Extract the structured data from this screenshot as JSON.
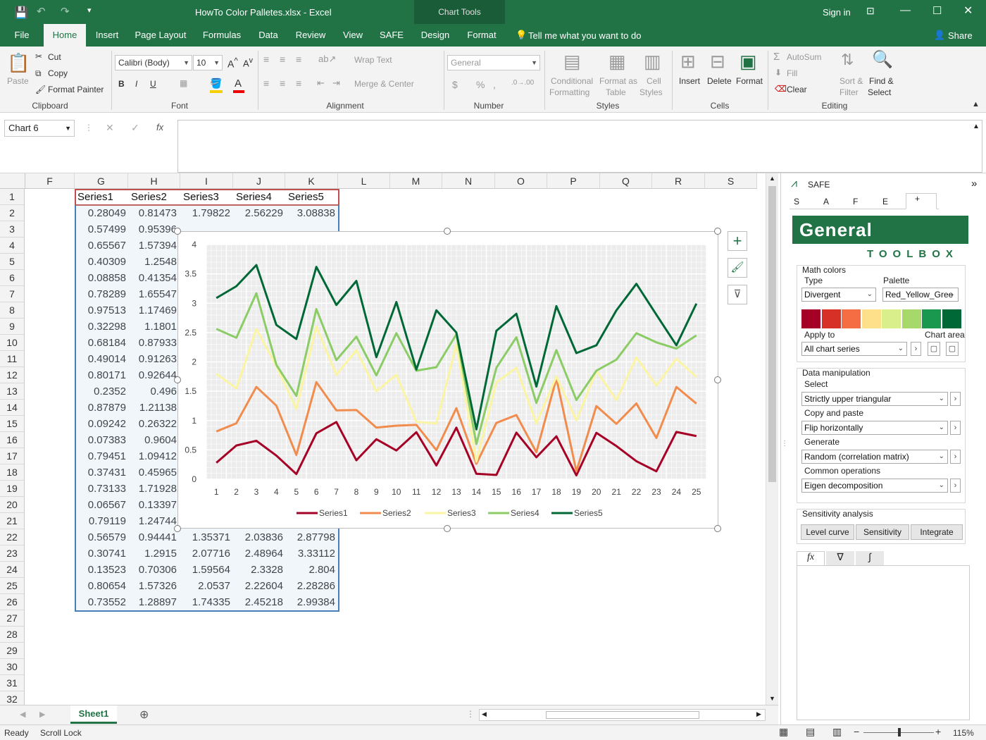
{
  "app": {
    "title": "HowTo Color Palletes.xlsx - Excel",
    "signin": "Sign in",
    "share": "Share",
    "chart_tools": "Chart Tools"
  },
  "tabs": [
    "File",
    "Home",
    "Insert",
    "Page Layout",
    "Formulas",
    "Data",
    "Review",
    "View",
    "SAFE",
    "Design",
    "Format"
  ],
  "tell_me": "Tell me what you want to do",
  "ribbon": {
    "clipboard": {
      "paste": "Paste",
      "cut": "Cut",
      "copy": "Copy",
      "format_painter": "Format Painter",
      "label": "Clipboard"
    },
    "font": {
      "name": "Calibri (Body)",
      "size": "10",
      "bold": "B",
      "italic": "I",
      "underline": "U",
      "label": "Font"
    },
    "alignment": {
      "wrap": "Wrap Text",
      "merge": "Merge & Center",
      "label": "Alignment"
    },
    "number": {
      "format": "General",
      "currency": "$",
      "percent": "%",
      "comma": ",",
      "label": "Number"
    },
    "styles": {
      "conditional": "Conditional",
      "formatting": "Formatting",
      "format_as": "Format as",
      "table": "Table",
      "cell": "Cell",
      "cell_styles": "Styles",
      "label": "Styles"
    },
    "cells": {
      "insert": "Insert",
      "delete": "Delete",
      "format": "Format",
      "label": "Cells"
    },
    "editing": {
      "autosum": "AutoSum",
      "fill": "Fill",
      "clear": "Clear",
      "sort": "Sort &",
      "filter": "Filter",
      "find": "Find &",
      "select": "Select",
      "label": "Editing"
    }
  },
  "formula_bar": {
    "name_box": "Chart 6",
    "fx": "fx",
    "value": ""
  },
  "grid": {
    "columns": [
      "F",
      "G",
      "H",
      "I",
      "J",
      "K",
      "L",
      "M",
      "N",
      "O",
      "P",
      "Q",
      "R",
      "S"
    ],
    "rows": [
      "1",
      "2",
      "3",
      "4",
      "5",
      "6",
      "7",
      "8",
      "9",
      "10",
      "11",
      "12",
      "13",
      "14",
      "15",
      "16",
      "17",
      "18",
      "19",
      "20",
      "21",
      "22",
      "23",
      "24",
      "25",
      "26",
      "27",
      "28",
      "29",
      "30",
      "31",
      "32"
    ],
    "headers": [
      "Series1",
      "Series2",
      "Series3",
      "Series4",
      "Series5"
    ],
    "visible_G": [
      "0.28049",
      "0.57499",
      "0.65567",
      "0.40309",
      "0.08858",
      "0.78289",
      "0.97513",
      "0.32298",
      "0.68184",
      "0.49014",
      "0.80171",
      "0.2352",
      "0.87879",
      "0.09242",
      "0.07383",
      "0.79451",
      "0.37431",
      "0.73133",
      "0.06567",
      "0.79119",
      "0.56579",
      "0.30741",
      "0.13523",
      "0.80654",
      "0.73552"
    ],
    "visible_H": [
      "0.81473",
      "0.95396",
      "1.57394",
      "1.2548",
      "0.41354",
      "1.65547",
      "1.17469",
      "1.1801",
      "0.87933",
      "0.91263",
      "0.92644",
      "0.496",
      "1.21138",
      "0.26322",
      "0.9604",
      "1.09412",
      "0.45965",
      "1.71928",
      "0.13397",
      "1.24744",
      "0.94441",
      "1.2915",
      "0.70306",
      "1.57326",
      "1.28897"
    ],
    "row2_IJK": [
      "1.79822",
      "2.56229",
      "3.08838"
    ],
    "row3_IJK": [
      "1.54586",
      "2.4115",
      "3.28976"
    ],
    "rows22_26_IJK": [
      [
        "1.35371",
        "2.03836",
        "2.87798"
      ],
      [
        "2.07716",
        "2.48964",
        "3.33112"
      ],
      [
        "1.59564",
        "2.3328",
        "2.804"
      ],
      [
        "2.0537",
        "2.22604",
        "2.28286"
      ],
      [
        "1.74335",
        "2.45218",
        "2.99384"
      ]
    ]
  },
  "chart_data": {
    "type": "line",
    "x": [
      1,
      2,
      3,
      4,
      5,
      6,
      7,
      8,
      9,
      10,
      11,
      12,
      13,
      14,
      15,
      16,
      17,
      18,
      19,
      20,
      21,
      22,
      23,
      24,
      25
    ],
    "ylim": [
      0,
      4
    ],
    "yticks": [
      "0",
      "0.5",
      "1",
      "1.5",
      "2",
      "2.5",
      "3",
      "3.5",
      "4"
    ],
    "grid": true,
    "legend_position": "bottom",
    "series": [
      {
        "name": "Series1",
        "color": "#a50026",
        "values": [
          0.28049,
          0.57499,
          0.65567,
          0.40309,
          0.08858,
          0.78289,
          0.97513,
          0.32298,
          0.68184,
          0.49014,
          0.80171,
          0.2352,
          0.87879,
          0.09242,
          0.07383,
          0.79451,
          0.37431,
          0.73133,
          0.06567,
          0.79119,
          0.56579,
          0.30741,
          0.13523,
          0.80654,
          0.73552
        ]
      },
      {
        "name": "Series2",
        "color": "#f08c4e",
        "values": [
          0.81473,
          0.95396,
          1.57394,
          1.2548,
          0.41354,
          1.65547,
          1.17469,
          1.1801,
          0.87933,
          0.91263,
          0.92644,
          0.496,
          1.21138,
          0.26322,
          0.9604,
          1.09412,
          0.45965,
          1.71928,
          0.13397,
          1.24744,
          0.94441,
          1.2915,
          0.70306,
          1.57326,
          1.28897
        ]
      },
      {
        "name": "Series3",
        "color": "#fbf5a3",
        "values": [
          1.79822,
          1.54586,
          2.56,
          1.93,
          1.2,
          2.6,
          1.78,
          2.2,
          1.5,
          1.78,
          0.98,
          0.95,
          2.3,
          0.3,
          1.65,
          1.9,
          0.95,
          1.75,
          1.0,
          1.85,
          1.35,
          2.07716,
          1.59564,
          2.0537,
          1.74335
        ]
      },
      {
        "name": "Series4",
        "color": "#8bcc66",
        "values": [
          2.56229,
          2.4115,
          3.17,
          1.95,
          1.42,
          2.9,
          2.03,
          2.43,
          1.77,
          2.49,
          1.85,
          1.91,
          2.47,
          0.6,
          1.9,
          2.42,
          1.3,
          2.2,
          1.35,
          1.85,
          2.03836,
          2.48964,
          2.3328,
          2.22604,
          2.45218
        ]
      },
      {
        "name": "Series5",
        "color": "#006837",
        "values": [
          3.08838,
          3.28976,
          3.65,
          2.63,
          2.39,
          3.62,
          2.97,
          3.38,
          2.08,
          3.02,
          1.87,
          2.88,
          2.5,
          0.85,
          2.53,
          2.82,
          1.58,
          2.95,
          2.15,
          2.28286,
          2.87798,
          3.33112,
          2.804,
          2.28286,
          2.99384
        ]
      }
    ]
  },
  "sheet": {
    "tab": "Sheet1"
  },
  "status": {
    "ready": "Ready",
    "scroll_lock": "Scroll Lock",
    "zoom": "115%"
  },
  "safe": {
    "title": "SAFE",
    "tabs": [
      "S",
      "A",
      "F",
      "E",
      "+"
    ],
    "banner": "General",
    "toolbox": "TOOLBOX",
    "math_colors": "Math colors",
    "type_label": "Type",
    "palette_label": "Palette",
    "type_value": "Divergent",
    "palette_value": "Red_Yellow_Gree",
    "palette_colors": [
      "#a50026",
      "#d73027",
      "#f46d43",
      "#fdae61",
      "#fee08b",
      "#d9ef8b",
      "#a6d96a",
      "#66bd63",
      "#1a9850",
      "#006837"
    ],
    "apply_to": "Apply to",
    "chart_area": "Chart area",
    "apply_value": "All chart series",
    "data_manip": "Data manipulation",
    "select_label": "Select",
    "select_value": "Strictly upper triangular",
    "copy_paste": "Copy and paste",
    "copy_value": "Flip horizontally",
    "generate": "Generate",
    "generate_value": "Random (correlation matrix)",
    "common_ops": "Common operations",
    "common_value": "Eigen decomposition",
    "sensitivity": "Sensitivity analysis",
    "level_curve": "Level curve",
    "sensitivity_btn": "Sensitivity",
    "integrate": "Integrate",
    "bottom_tabs": [
      "fx",
      "∇",
      "∫"
    ]
  }
}
